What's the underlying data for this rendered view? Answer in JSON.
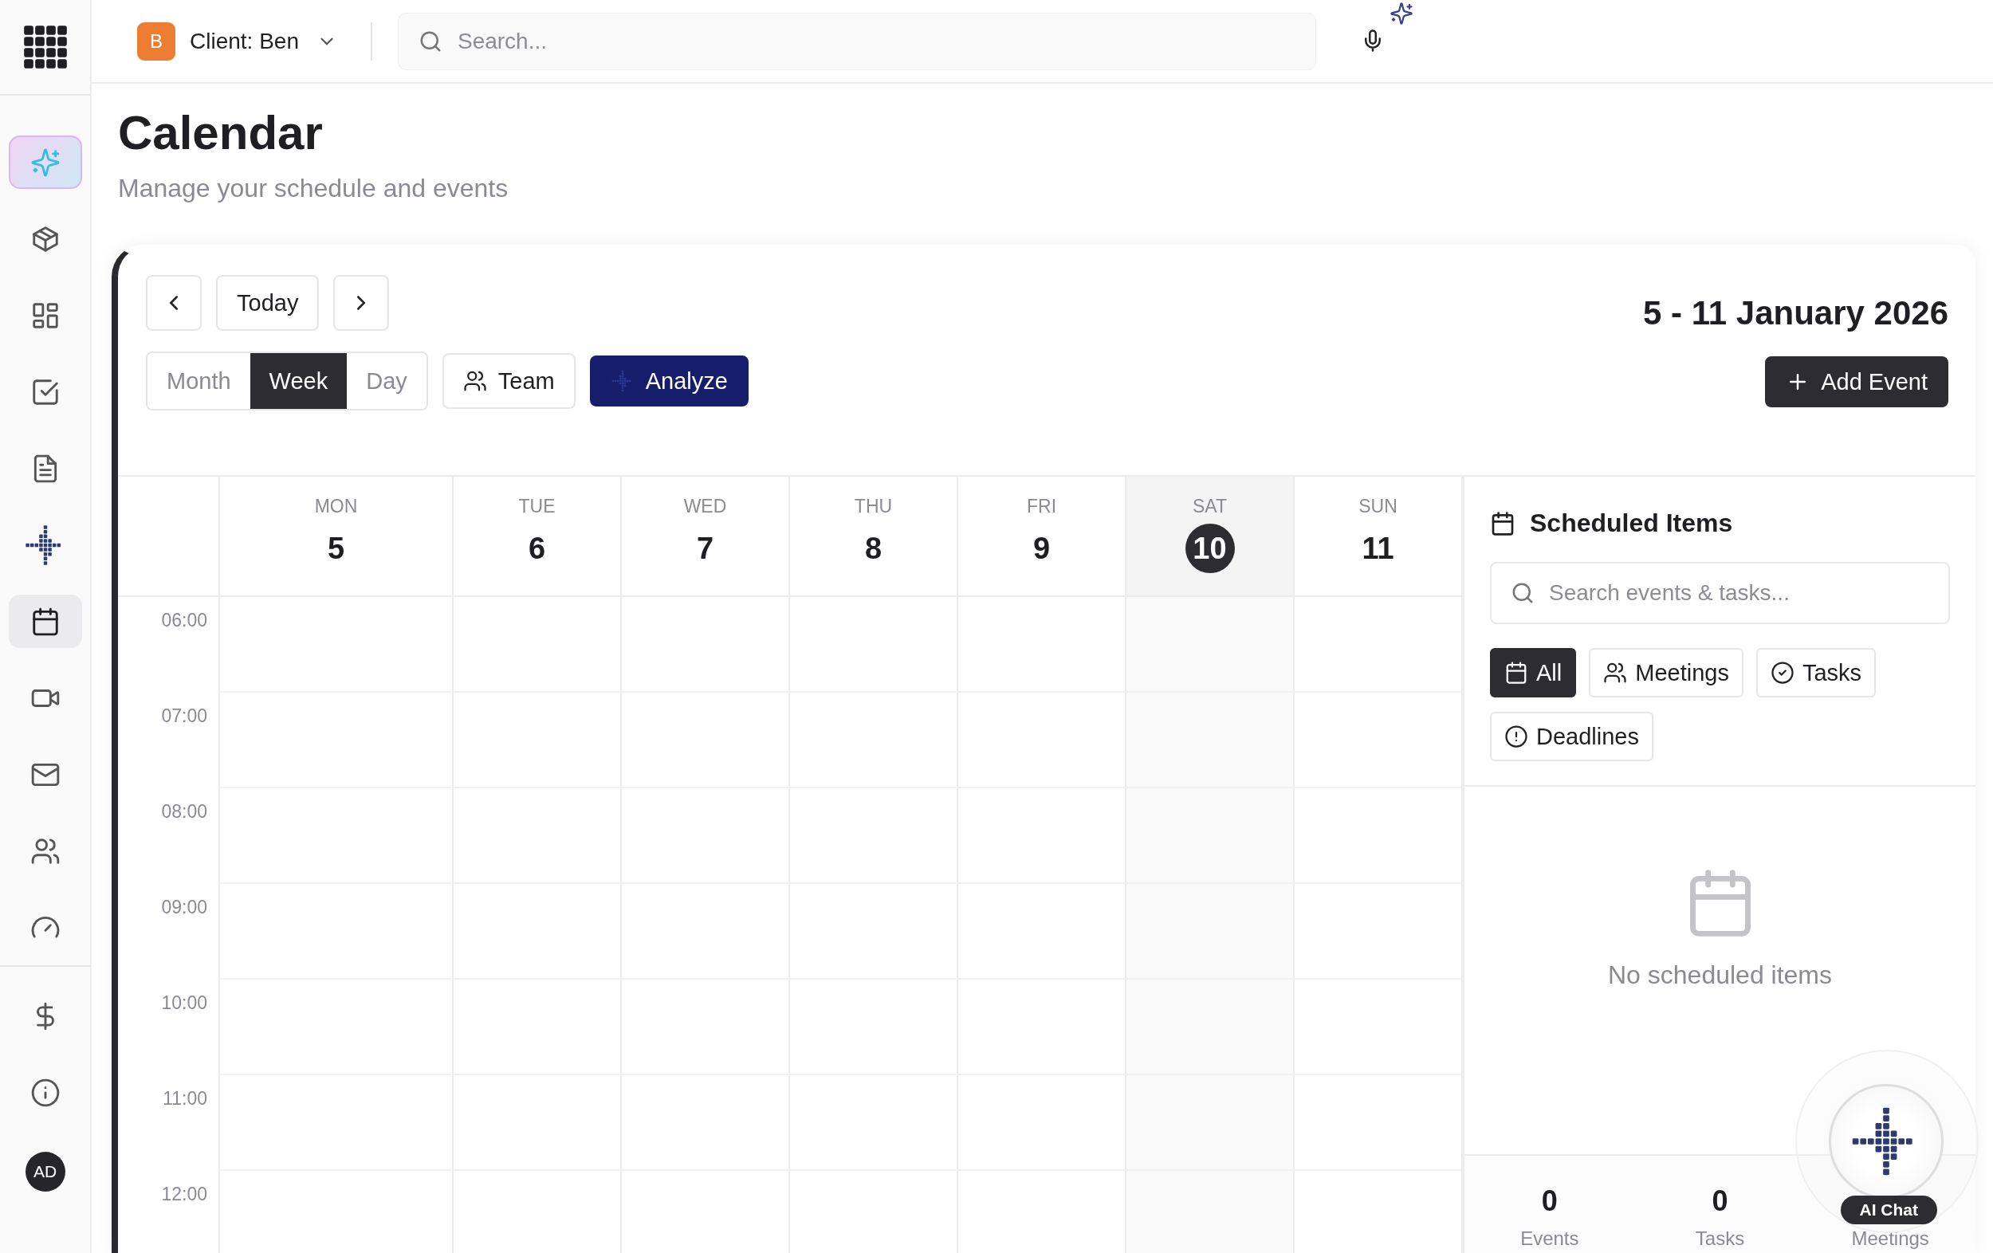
{
  "topbar": {
    "client": {
      "initial": "B",
      "label": "Client: Ben"
    },
    "search": {
      "placeholder": "Search..."
    }
  },
  "sidebar": {
    "items": [
      {
        "kind": "ai",
        "selected": false
      },
      {
        "kind": "cube",
        "selected": false
      },
      {
        "kind": "layout",
        "selected": false
      },
      {
        "kind": "checkbox",
        "selected": false
      },
      {
        "kind": "document",
        "selected": false
      },
      {
        "kind": "logo",
        "selected": false
      },
      {
        "kind": "calendar",
        "selected": true
      },
      {
        "kind": "video",
        "selected": false
      },
      {
        "kind": "mail",
        "selected": false
      },
      {
        "kind": "users",
        "selected": false
      },
      {
        "kind": "gauge",
        "selected": false
      }
    ],
    "bottom_items": [
      {
        "kind": "dollar",
        "selected": false
      },
      {
        "kind": "info",
        "selected": false
      }
    ],
    "avatar": "AD"
  },
  "page": {
    "title": "Calendar",
    "subtitle": "Manage your schedule and events"
  },
  "toolbar": {
    "today": "Today",
    "views": [
      {
        "label": "Month",
        "selected": false
      },
      {
        "label": "Week",
        "selected": true
      },
      {
        "label": "Day",
        "selected": false
      }
    ],
    "team": "Team",
    "analyze": "Analyze",
    "range": "5 - 11 January 2026",
    "add_event": "Add Event"
  },
  "calendar": {
    "days": [
      {
        "weekday": "MON",
        "date": "5",
        "selected": false
      },
      {
        "weekday": "TUE",
        "date": "6",
        "selected": false
      },
      {
        "weekday": "WED",
        "date": "7",
        "selected": false
      },
      {
        "weekday": "THU",
        "date": "8",
        "selected": false
      },
      {
        "weekday": "FRI",
        "date": "9",
        "selected": false
      },
      {
        "weekday": "SAT",
        "date": "10",
        "selected": true
      },
      {
        "weekday": "SUN",
        "date": "11",
        "selected": false
      }
    ],
    "times": [
      "06:00",
      "07:00",
      "08:00",
      "09:00",
      "10:00",
      "11:00",
      "12:00"
    ]
  },
  "panel": {
    "title": "Scheduled Items",
    "search": {
      "placeholder": "Search events & tasks..."
    },
    "filters": [
      {
        "label": "All",
        "kind": "calendar",
        "selected": true
      },
      {
        "label": "Meetings",
        "kind": "users",
        "selected": false
      },
      {
        "label": "Tasks",
        "kind": "check",
        "selected": false
      },
      {
        "label": "Deadlines",
        "kind": "alert",
        "selected": false
      }
    ],
    "empty": "No scheduled items",
    "stats": [
      {
        "value": "0",
        "label": "Events"
      },
      {
        "value": "0",
        "label": "Tasks"
      },
      {
        "label": "Meetings"
      }
    ]
  },
  "ai_chat": {
    "label": "AI Chat"
  }
}
